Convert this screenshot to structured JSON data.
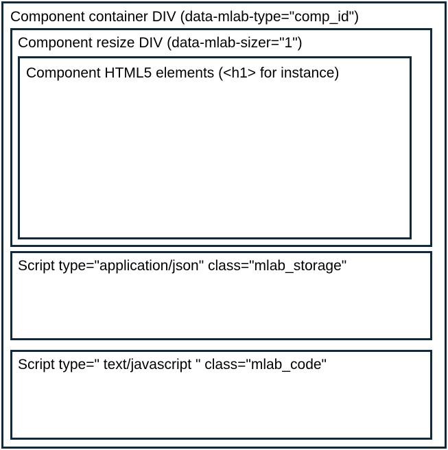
{
  "diagram": {
    "border_color": "#0f2a3f",
    "container": {
      "label": "Component container DIV  (data-mlab-type=\"comp_id\")"
    },
    "resizer": {
      "label": "Component resize DIV  (data-mlab-sizer=\"1\")"
    },
    "elements": {
      "label": "Component HTML5 elements (<h1> for instance)"
    },
    "storage": {
      "label": "Script type=\"application/json\" class=\"mlab_storage\""
    },
    "code": {
      "label": "Script type=\" text/javascript \" class=\"mlab_code\""
    }
  }
}
